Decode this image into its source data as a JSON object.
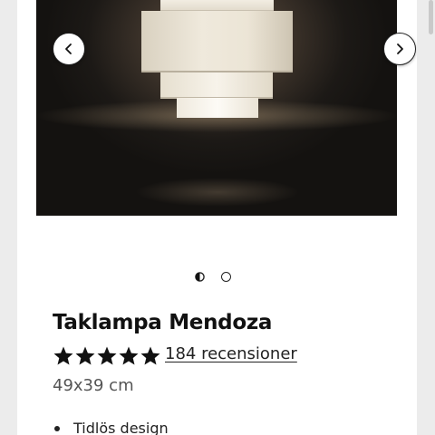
{
  "product": {
    "title": "Taklampa Mendoza",
    "rating_stars": 5,
    "reviews_label": "184 recensioner",
    "dimensions": "49x39 cm",
    "features": [
      "Tidlös design"
    ]
  },
  "carousel": {
    "slide_count": 2,
    "active_index": 0,
    "prev_icon": "chevron-left-icon",
    "next_icon": "chevron-right-icon"
  },
  "colors": {
    "page_background": "#ececec",
    "card_background": "#ffffff",
    "text": "#111111",
    "muted_text": "#555555"
  }
}
